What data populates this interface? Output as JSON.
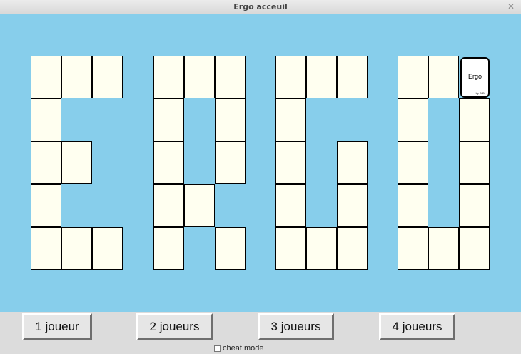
{
  "window": {
    "title": "Ergo acceuil",
    "close_icon": "close-icon"
  },
  "board": {
    "background_color": "#87ceeb",
    "tile_color": "#fffff0",
    "letters": [
      "E",
      "R",
      "G",
      "O"
    ],
    "card": {
      "title": "Ergo",
      "subtitle": "by D.D."
    }
  },
  "buttons": {
    "one_player": "1 joueur",
    "two_players": "2 joueurs",
    "three_players": "3 joueurs",
    "four_players": "4 joueurs"
  },
  "cheat_mode": {
    "label": "cheat mode",
    "checked": false
  }
}
